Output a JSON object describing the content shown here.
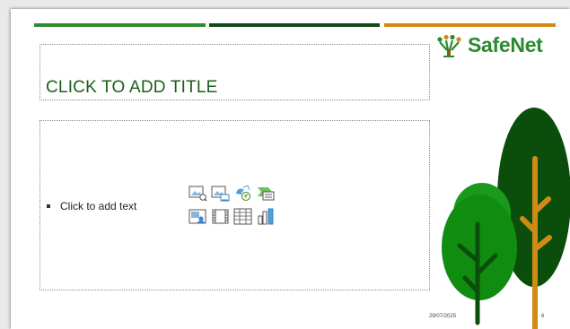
{
  "slide": {
    "title_placeholder": "CLICK TO ADD TITLE",
    "content_placeholder": "Click to add text",
    "insert_icons": [
      "insert-picture-icon",
      "insert-online-picture-icon",
      "insert-icons-icon",
      "insert-smartart-icon",
      "insert-cameo-icon",
      "insert-video-icon",
      "insert-table-icon",
      "insert-chart-icon"
    ]
  },
  "logo": {
    "text": "SafeNet"
  },
  "footer": {
    "date": "29/07/2025",
    "page_number": "6"
  },
  "colors": {
    "accent_green": "#2e8b2e",
    "accent_dark_green": "#0f4a15",
    "accent_orange": "#d08b17",
    "title_green": "#1a5e1a"
  }
}
